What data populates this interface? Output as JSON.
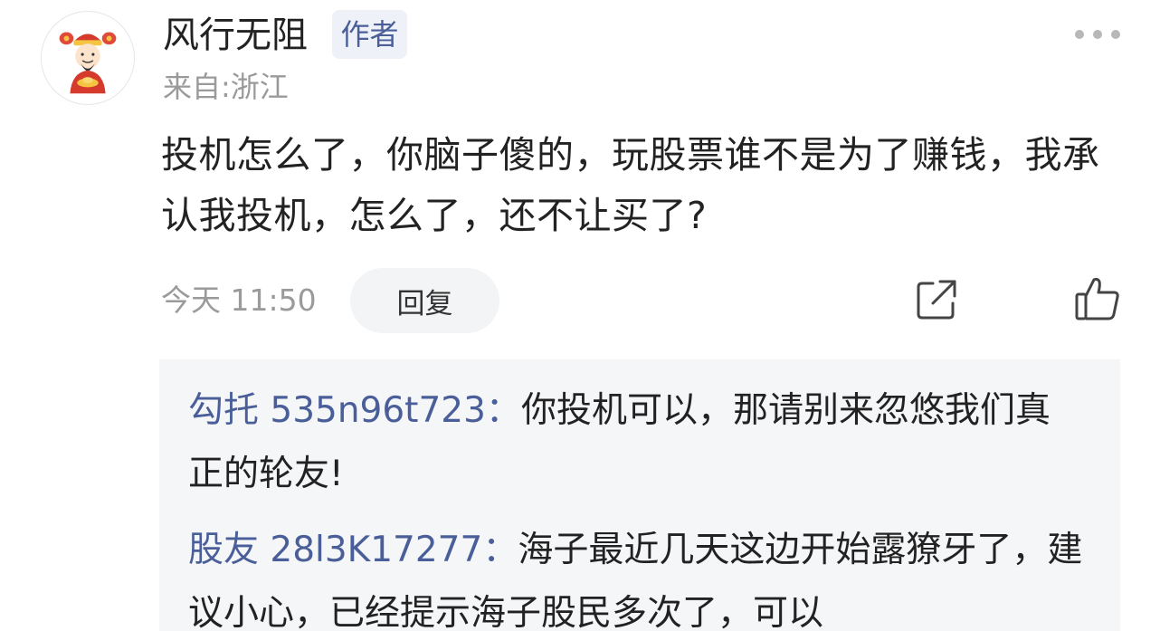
{
  "comment": {
    "username": "风行无阻",
    "author_badge": "作者",
    "location": "来自:浙江",
    "content": "投机怎么了，你脑子傻的，玩股票谁不是为了赚钱，我承认我投机，怎么了，还不让买了?",
    "time": "今天 11:50",
    "reply_label": "回复"
  },
  "replies": [
    {
      "user": "勾托 535n96t723",
      "separator": "：",
      "text": "你投机可以，那请别来忽悠我们真正的轮友!"
    },
    {
      "user": "股友 28l3K17277",
      "separator": "：",
      "text": "海子最近几天这边开始露獠牙了，建议小心，已经提示海子股民多次了，可以"
    }
  ],
  "icons": {
    "more": "more-dots-icon",
    "share": "share-icon",
    "like": "thumbs-up-icon",
    "avatar": "caishen-avatar"
  },
  "colors": {
    "badge_background": "#eef1f7",
    "link_blue": "#4a5f9a",
    "reply_panel": "#f5f6f8",
    "muted_text": "#9a9a9a"
  }
}
